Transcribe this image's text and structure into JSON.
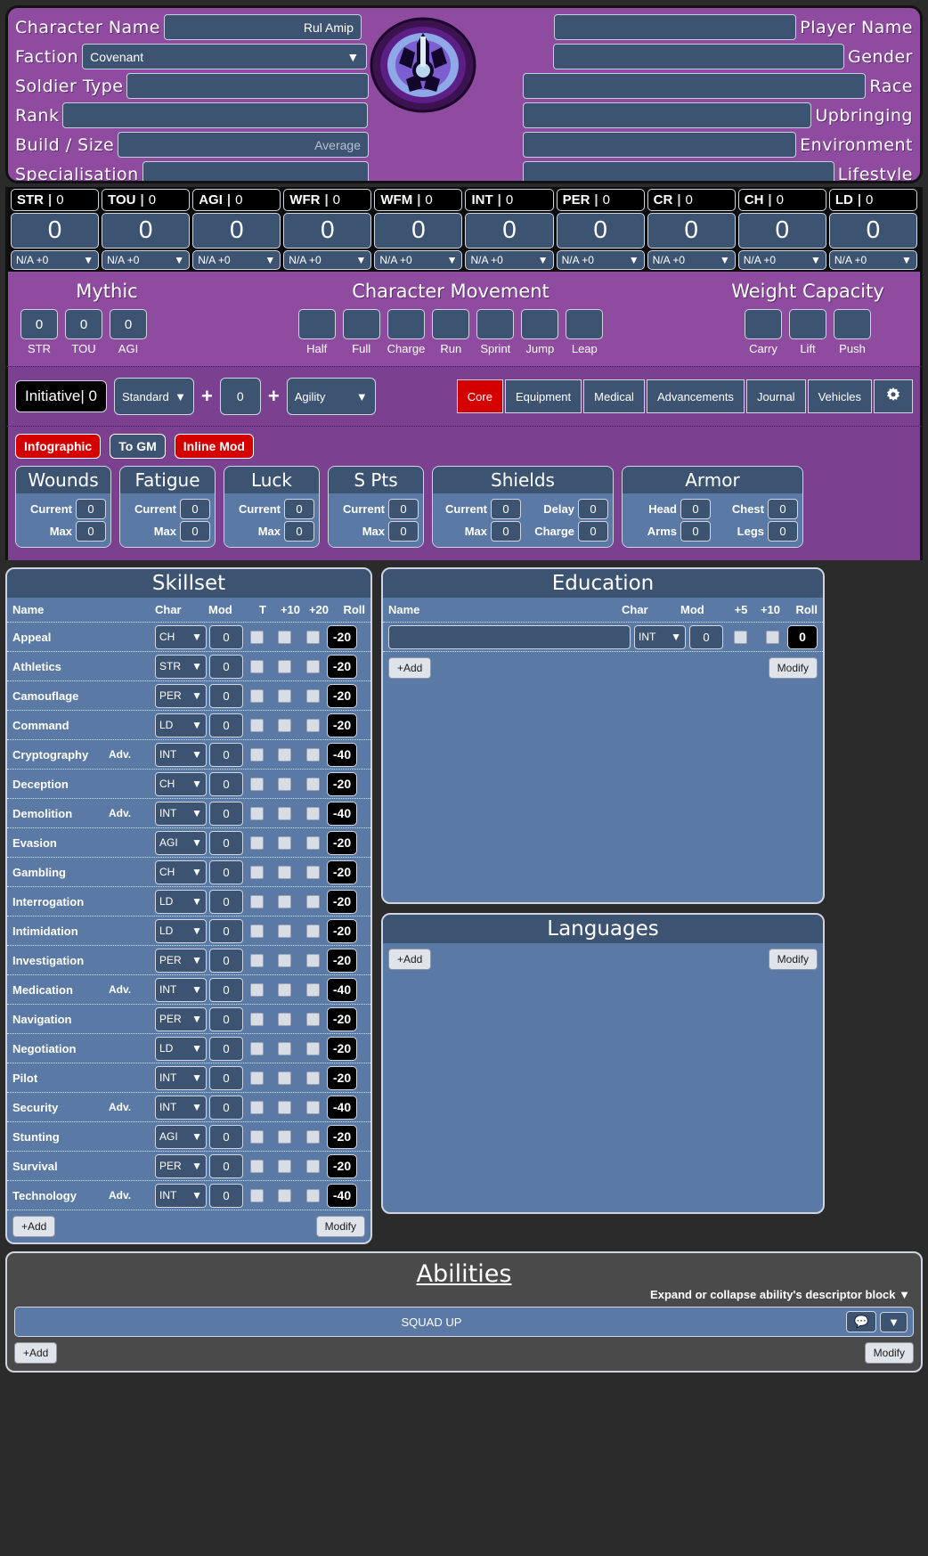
{
  "header": {
    "left_fields": [
      {
        "label": "Character Name",
        "value": "Rul Amip",
        "type": "text"
      },
      {
        "label": "Faction",
        "value": "Covenant",
        "type": "select"
      },
      {
        "label": "Soldier Type",
        "value": "",
        "type": "text"
      },
      {
        "label": "Rank",
        "value": "",
        "type": "text"
      },
      {
        "label": "Build / Size",
        "value": "Average",
        "type": "placeholder"
      },
      {
        "label": "Specialisation",
        "value": "",
        "type": "text"
      }
    ],
    "right_fields": [
      {
        "label": "Player Name",
        "value": ""
      },
      {
        "label": "Gender",
        "value": ""
      },
      {
        "label": "Race",
        "value": ""
      },
      {
        "label": "Upbringing",
        "value": ""
      },
      {
        "label": "Environment",
        "value": ""
      },
      {
        "label": "Lifestyle",
        "value": ""
      }
    ],
    "emblem": "covenant-emblem"
  },
  "stats": [
    {
      "abbr": "STR",
      "head_value": "0",
      "value": "0",
      "mod": "N/A +0"
    },
    {
      "abbr": "TOU",
      "head_value": "0",
      "value": "0",
      "mod": "N/A +0"
    },
    {
      "abbr": "AGI",
      "head_value": "0",
      "value": "0",
      "mod": "N/A +0"
    },
    {
      "abbr": "WFR",
      "head_value": "0",
      "value": "0",
      "mod": "N/A +0"
    },
    {
      "abbr": "WFM",
      "head_value": "0",
      "value": "0",
      "mod": "N/A +0"
    },
    {
      "abbr": "INT",
      "head_value": "0",
      "value": "0",
      "mod": "N/A +0"
    },
    {
      "abbr": "PER",
      "head_value": "0",
      "value": "0",
      "mod": "N/A +0"
    },
    {
      "abbr": "CR",
      "head_value": "0",
      "value": "0",
      "mod": "N/A +0"
    },
    {
      "abbr": "CH",
      "head_value": "0",
      "value": "0",
      "mod": "N/A +0"
    },
    {
      "abbr": "LD",
      "head_value": "0",
      "value": "0",
      "mod": "N/A +0"
    }
  ],
  "mythic": {
    "title": "Mythic",
    "items": [
      {
        "label": "STR",
        "value": "0"
      },
      {
        "label": "TOU",
        "value": "0"
      },
      {
        "label": "AGI",
        "value": "0"
      }
    ]
  },
  "movement": {
    "title": "Character Movement",
    "items": [
      {
        "label": "Half",
        "value": ""
      },
      {
        "label": "Full",
        "value": ""
      },
      {
        "label": "Charge",
        "value": ""
      },
      {
        "label": "Run",
        "value": ""
      },
      {
        "label": "Sprint",
        "value": ""
      },
      {
        "label": "Jump",
        "value": ""
      },
      {
        "label": "Leap",
        "value": ""
      }
    ]
  },
  "weight": {
    "title": "Weight Capacity",
    "items": [
      {
        "label": "Carry",
        "value": ""
      },
      {
        "label": "Lift",
        "value": ""
      },
      {
        "label": "Push",
        "value": ""
      }
    ]
  },
  "initiative": {
    "badge": "Initiative| 0",
    "formula_select": "Standard",
    "plus1": "+",
    "bonus": "0",
    "plus2": "+",
    "char_select": "Agility"
  },
  "tabs": [
    {
      "label": "Core",
      "active": true
    },
    {
      "label": "Equipment",
      "active": false
    },
    {
      "label": "Medical",
      "active": false
    },
    {
      "label": "Advancements",
      "active": false
    },
    {
      "label": "Journal",
      "active": false
    },
    {
      "label": "Vehicles",
      "active": false
    }
  ],
  "gear_icon": "gear-icon",
  "chips": [
    {
      "label": "Infographic",
      "style": "red"
    },
    {
      "label": "To GM",
      "style": "blue"
    },
    {
      "label": "Inline Mod",
      "style": "red"
    }
  ],
  "status": [
    {
      "title": "Wounds",
      "rows": [
        {
          "label": "Current",
          "value": "0"
        },
        {
          "label": "Max",
          "value": "0"
        }
      ]
    },
    {
      "title": "Fatigue",
      "rows": [
        {
          "label": "Current",
          "value": "0"
        },
        {
          "label": "Max",
          "value": "0"
        }
      ]
    },
    {
      "title": "Luck",
      "rows": [
        {
          "label": "Current",
          "value": "0"
        },
        {
          "label": "Max",
          "value": "0"
        }
      ]
    },
    {
      "title": "S Pts",
      "rows": [
        {
          "label": "Current",
          "value": "0"
        },
        {
          "label": "Max",
          "value": "0"
        }
      ]
    },
    {
      "title": "Shields",
      "rows": [
        {
          "label": "Current",
          "value": "0"
        },
        {
          "label": "Delay",
          "value": "0"
        },
        {
          "label": "Max",
          "value": "0"
        },
        {
          "label": "Charge",
          "value": "0"
        }
      ],
      "two_col": true
    },
    {
      "title": "Armor",
      "rows": [
        {
          "label": "Head",
          "value": "0"
        },
        {
          "label": "Chest",
          "value": "0"
        },
        {
          "label": "Arms",
          "value": "0"
        },
        {
          "label": "Legs",
          "value": "0"
        }
      ],
      "two_col": true
    }
  ],
  "skillset": {
    "title": "Skillset",
    "columns": [
      "Name",
      "Char",
      "Mod",
      "T",
      "+10",
      "+20",
      "Roll"
    ],
    "rows": [
      {
        "name": "Appeal",
        "adv": "",
        "char": "CH",
        "mod": "0",
        "roll": "-20"
      },
      {
        "name": "Athletics",
        "adv": "",
        "char": "STR",
        "mod": "0",
        "roll": "-20"
      },
      {
        "name": "Camouflage",
        "adv": "",
        "char": "PER",
        "mod": "0",
        "roll": "-20"
      },
      {
        "name": "Command",
        "adv": "",
        "char": "LD",
        "mod": "0",
        "roll": "-20"
      },
      {
        "name": "Cryptography",
        "adv": "Adv.",
        "char": "INT",
        "mod": "0",
        "roll": "-40"
      },
      {
        "name": "Deception",
        "adv": "",
        "char": "CH",
        "mod": "0",
        "roll": "-20"
      },
      {
        "name": "Demolition",
        "adv": "Adv.",
        "char": "INT",
        "mod": "0",
        "roll": "-40"
      },
      {
        "name": "Evasion",
        "adv": "",
        "char": "AGI",
        "mod": "0",
        "roll": "-20"
      },
      {
        "name": "Gambling",
        "adv": "",
        "char": "CH",
        "mod": "0",
        "roll": "-20"
      },
      {
        "name": "Interrogation",
        "adv": "",
        "char": "LD",
        "mod": "0",
        "roll": "-20"
      },
      {
        "name": "Intimidation",
        "adv": "",
        "char": "LD",
        "mod": "0",
        "roll": "-20"
      },
      {
        "name": "Investigation",
        "adv": "",
        "char": "PER",
        "mod": "0",
        "roll": "-20"
      },
      {
        "name": "Medication",
        "adv": "Adv.",
        "char": "INT",
        "mod": "0",
        "roll": "-40"
      },
      {
        "name": "Navigation",
        "adv": "",
        "char": "PER",
        "mod": "0",
        "roll": "-20"
      },
      {
        "name": "Negotiation",
        "adv": "",
        "char": "LD",
        "mod": "0",
        "roll": "-20"
      },
      {
        "name": "Pilot",
        "adv": "",
        "char": "INT",
        "mod": "0",
        "roll": "-20"
      },
      {
        "name": "Security",
        "adv": "Adv.",
        "char": "INT",
        "mod": "0",
        "roll": "-40"
      },
      {
        "name": "Stunting",
        "adv": "",
        "char": "AGI",
        "mod": "0",
        "roll": "-20"
      },
      {
        "name": "Survival",
        "adv": "",
        "char": "PER",
        "mod": "0",
        "roll": "-20"
      },
      {
        "name": "Technology",
        "adv": "Adv.",
        "char": "INT",
        "mod": "0",
        "roll": "-40"
      }
    ],
    "add_label": "+Add",
    "modify_label": "Modify"
  },
  "education": {
    "title": "Education",
    "columns": [
      "Name",
      "Char",
      "Mod",
      "+5",
      "+10",
      "Roll"
    ],
    "rows": [
      {
        "name": "",
        "char": "INT",
        "mod": "0",
        "roll": "0"
      }
    ],
    "add_label": "+Add",
    "modify_label": "Modify"
  },
  "languages": {
    "title": "Languages",
    "add_label": "+Add",
    "modify_label": "Modify"
  },
  "abilities": {
    "title": "Abilities",
    "hint": "Expand or collapse ability's descriptor block",
    "hint_icon": "chevron-down-icon",
    "rows": [
      {
        "name": "SQUAD UP",
        "chat_icon": "chat-icon",
        "expand_icon": "chevron-down-icon"
      }
    ],
    "add_label": "+Add",
    "modify_label": "Modify"
  },
  "colors": {
    "purple": "#8e4ba0",
    "purple_dark": "#7c4090",
    "slate": "#3d5372",
    "slate_light": "#5a79a5",
    "red": "#d40000",
    "black": "#000000"
  }
}
